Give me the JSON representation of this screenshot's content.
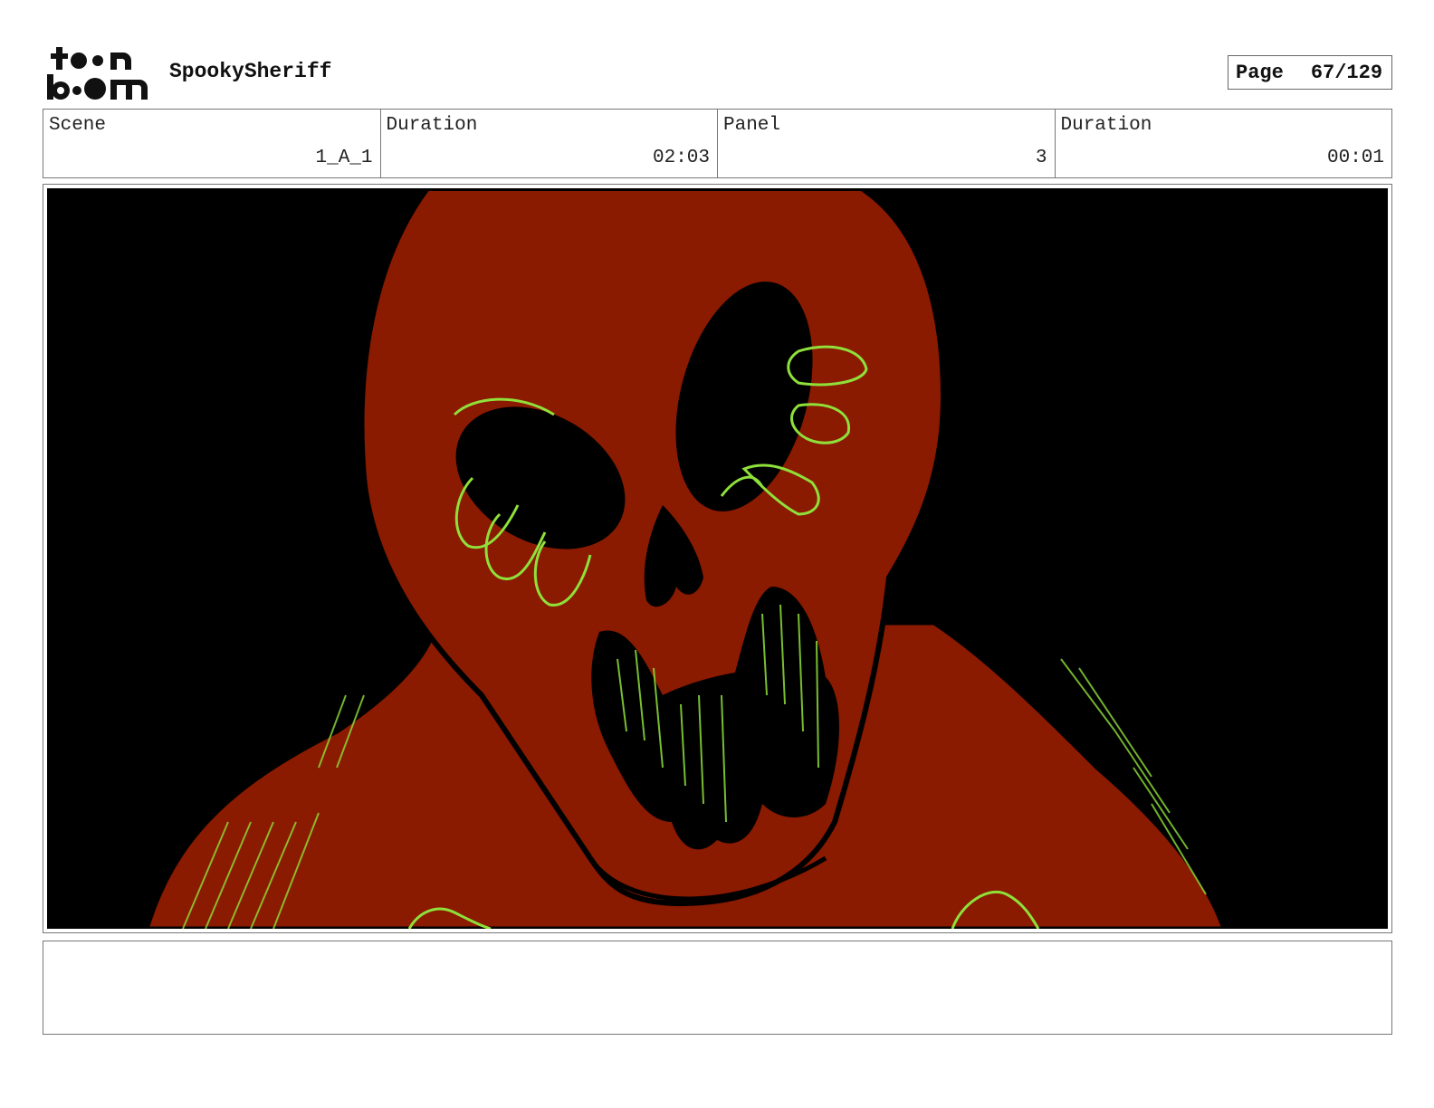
{
  "header": {
    "logo_text": "toonboom",
    "project_title": "SpookySheriff",
    "page_label": "Page",
    "page_number": "67/129"
  },
  "info": {
    "scene_label": "Scene",
    "scene_value": "1_A_1",
    "scene_duration_label": "Duration",
    "scene_duration_value": "02:03",
    "panel_label": "Panel",
    "panel_value": "3",
    "panel_duration_label": "Duration",
    "panel_duration_value": "00:01"
  },
  "panel": {
    "colors": {
      "background": "#000000",
      "skull": "#8a1a00",
      "outline": "#000000",
      "accent": "#8fe03a"
    }
  },
  "notes": {
    "text": ""
  }
}
